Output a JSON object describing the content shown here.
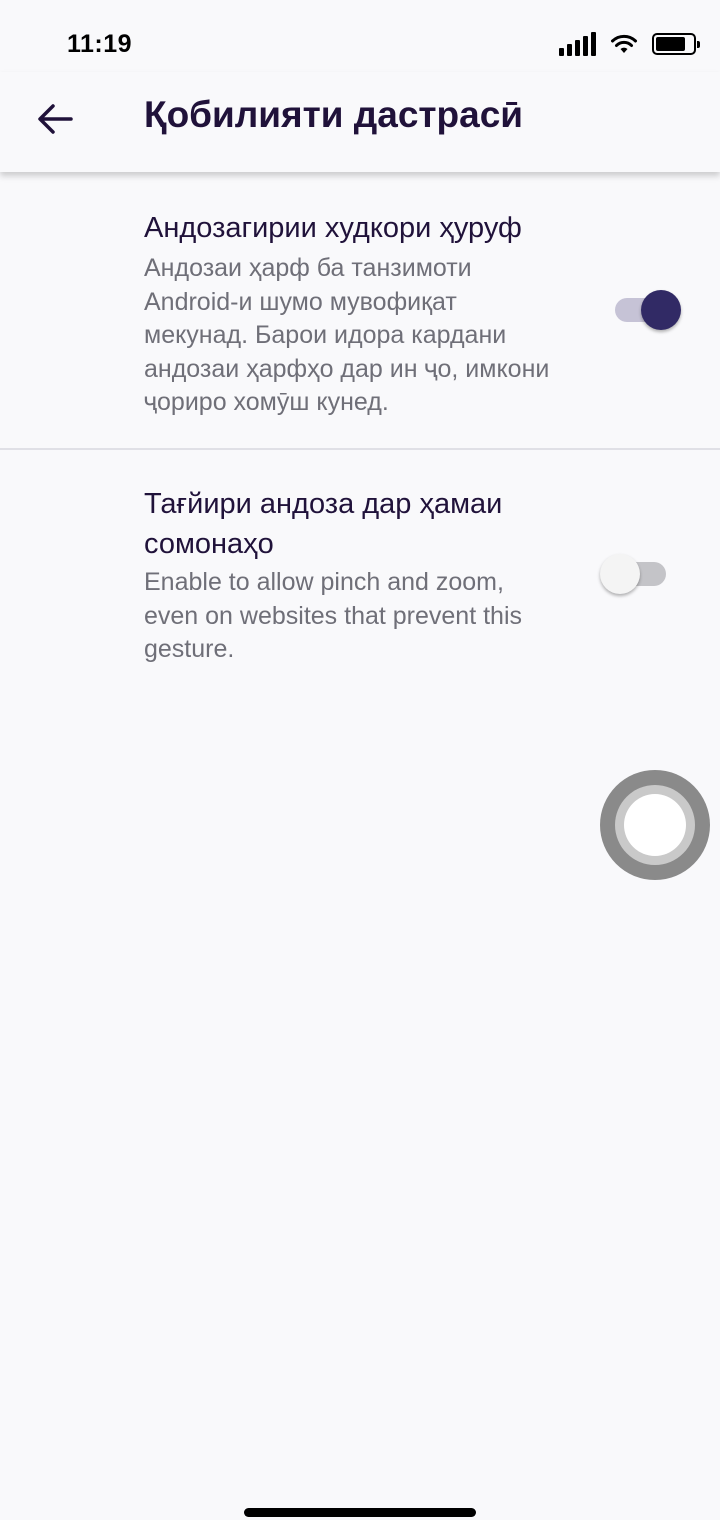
{
  "status_bar": {
    "time": "11:19",
    "icons": [
      "signal-icon",
      "wifi-icon",
      "battery-icon"
    ],
    "battery_level": 0.8
  },
  "toolbar": {
    "back_icon": "arrow-left-icon",
    "title": "Қобилияти дастрасӣ"
  },
  "settings": [
    {
      "title": "Андозагирии худкори ҳуруф",
      "description": "Андозаи ҳарф ба танзимоти Android-и шумо мувофиқат мекунад. Барои идора кардани андозаи ҳарфҳо дар ин ҷо, имкони ҷориро хомӯш кунед.",
      "enabled": true
    },
    {
      "title": "Тағйири андоза дар ҳамаи сомонаҳо",
      "description": "Enable to allow pinch and zoom, even on websites that prevent this gesture.",
      "enabled": false
    }
  ],
  "colors": {
    "accent": "#312a65",
    "accent_track": "#c6c3d6",
    "off_track": "#c4c4c8",
    "off_thumb": "#f4f4f4",
    "title_text": "#20123a",
    "secondary_text": "#6f6f78",
    "background": "#f9f9fb"
  },
  "overlay": {
    "assistive_touch_icon": "assistive-touch-icon"
  }
}
